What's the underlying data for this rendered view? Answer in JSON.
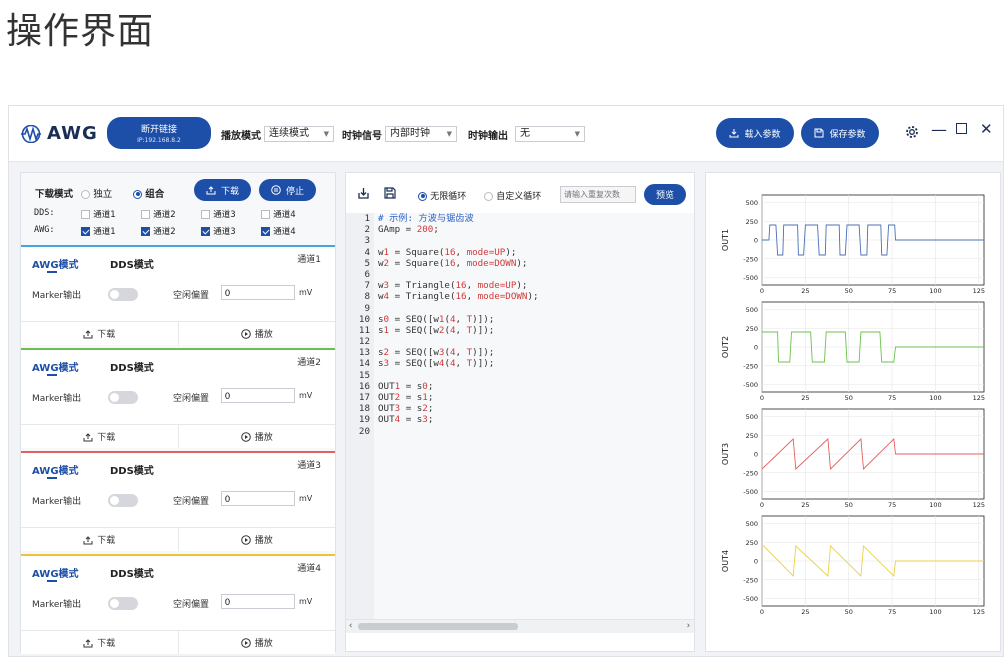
{
  "page_title": "操作界面",
  "app": {
    "logo_text": "AWG",
    "disconnect": {
      "label": "断开链接",
      "ip": "IP:192.168.8.2"
    },
    "play_mode": {
      "label": "播放模式",
      "value": "连续模式"
    },
    "clock_signal": {
      "label": "时钟信号",
      "value": "内部时钟"
    },
    "clock_output": {
      "label": "时钟输出",
      "value": "无"
    },
    "load_params": "载入参数",
    "save_params": "保存参数"
  },
  "left": {
    "download_mode_label": "下载模式",
    "independent": "独立",
    "combined": "组合",
    "download_btn": "下载",
    "stop_btn": "停止",
    "dds_label": "DDS:",
    "awg_label": "AWG:",
    "channels": [
      "通道1",
      "通道2",
      "通道3",
      "通道4"
    ],
    "dds_checked": [
      false,
      false,
      false,
      false
    ],
    "awg_checked": [
      true,
      true,
      true,
      true
    ]
  },
  "channel_cards": [
    {
      "awg_tab": "AWG模式",
      "dds_tab": "DDS模式",
      "name": "通道1",
      "marker": "Marker输出",
      "idle": "空闲偏置",
      "value": "0",
      "unit": "mV",
      "download": "下载",
      "play": "播放",
      "color": "#4aa3df"
    },
    {
      "awg_tab": "AWG模式",
      "dds_tab": "DDS模式",
      "name": "通道2",
      "marker": "Marker输出",
      "idle": "空闲偏置",
      "value": "0",
      "unit": "mV",
      "download": "下载",
      "play": "播放",
      "color": "#6cc14c"
    },
    {
      "awg_tab": "AWG模式",
      "dds_tab": "DDS模式",
      "name": "通道3",
      "marker": "Marker输出",
      "idle": "空闲偏置",
      "value": "0",
      "unit": "mV",
      "download": "下载",
      "play": "播放",
      "color": "#e26060"
    },
    {
      "awg_tab": "AWG模式",
      "dds_tab": "DDS模式",
      "name": "通道4",
      "marker": "Marker输出",
      "idle": "空闲偏置",
      "value": "0",
      "unit": "mV",
      "download": "下载",
      "play": "播放",
      "color": "#e8c53a"
    }
  ],
  "editor": {
    "infinite_loop": "无限循环",
    "custom_loop": "自定义循环",
    "repeat_placeholder": "请输入重复次数",
    "preview_btn": "预览",
    "line_numbers": [
      "1",
      "2",
      "3",
      "4",
      "5",
      "6",
      "7",
      "8",
      "9",
      "10",
      "11",
      "12",
      "13",
      "14",
      "15",
      "16",
      "17",
      "18",
      "19",
      "20"
    ],
    "code_lines": [
      "# 示例: 方波与锯齿波",
      "GAmp = 200;",
      "",
      "w1 = Square(16, mode=UP);",
      "w2 = Square(16, mode=DOWN);",
      "",
      "w3 = Triangle(16, mode=UP);",
      "w4 = Triangle(16, mode=DOWN);",
      "",
      "s0 = SEQ([w1(4, T)]);",
      "s1 = SEQ([w2(4, T)]);",
      "",
      "s2 = SEQ([w3(4, T)]);",
      "s3 = SEQ([w4(4, T)]);",
      "",
      "OUT1 = s0;",
      "OUT2 = s1;",
      "OUT3 = s2;",
      "OUT4 = s3;",
      ""
    ]
  },
  "chart_data": [
    {
      "type": "line",
      "ylabel": "OUT1",
      "color": "#4b6fb5",
      "x_ticks": [
        0,
        25,
        50,
        75,
        100,
        125
      ],
      "y_ticks": [
        500,
        250,
        0,
        -250,
        -500
      ],
      "xlim": [
        0,
        128
      ],
      "ylim": [
        -600,
        600
      ],
      "x": [
        0,
        4,
        4.5,
        8,
        9,
        12,
        12.5,
        16,
        17,
        20.5,
        21,
        24,
        25,
        28.5,
        29,
        32,
        33,
        36.5,
        37,
        40,
        41,
        44.5,
        45,
        48,
        49,
        52.5,
        53,
        56,
        57,
        60.5,
        61,
        64,
        65,
        68.5,
        69,
        72,
        73,
        76.5,
        77,
        128
      ],
      "y": [
        0,
        0,
        200,
        200,
        -200,
        -200,
        200,
        200,
        200,
        200,
        -200,
        -200,
        200,
        200,
        200,
        200,
        -200,
        -200,
        200,
        200,
        200,
        200,
        -200,
        -200,
        200,
        200,
        200,
        200,
        -200,
        -200,
        200,
        200,
        200,
        200,
        -200,
        -200,
        200,
        200,
        0,
        0
      ]
    },
    {
      "type": "line",
      "ylabel": "OUT2",
      "color": "#6cc14c",
      "x_ticks": [
        0,
        25,
        50,
        75,
        100,
        125
      ],
      "y_ticks": [
        500,
        250,
        0,
        -250,
        -500
      ],
      "xlim": [
        0,
        128
      ],
      "ylim": [
        -600,
        600
      ],
      "x": [
        0,
        9,
        9.5,
        16,
        17,
        20.5,
        21,
        28,
        29,
        36,
        37,
        40,
        41,
        48,
        49,
        56,
        57,
        60,
        61,
        68,
        69,
        76,
        77,
        128
      ],
      "y": [
        200,
        200,
        -200,
        -200,
        200,
        200,
        200,
        200,
        -200,
        -200,
        200,
        200,
        200,
        200,
        -200,
        -200,
        200,
        200,
        200,
        200,
        -200,
        -200,
        0,
        0
      ]
    },
    {
      "type": "line",
      "ylabel": "OUT3",
      "color": "#e26060",
      "x_ticks": [
        0,
        25,
        50,
        75,
        100,
        125
      ],
      "y_ticks": [
        500,
        250,
        0,
        -250,
        -500
      ],
      "xlim": [
        0,
        128
      ],
      "ylim": [
        -600,
        600
      ],
      "x": [
        0,
        18,
        19.5,
        38,
        39.5,
        57,
        58.5,
        76,
        77,
        128
      ],
      "y": [
        -200,
        200,
        -200,
        200,
        -200,
        200,
        -200,
        200,
        0,
        0
      ]
    },
    {
      "type": "line",
      "ylabel": "OUT4",
      "color": "#e8d24a",
      "x_ticks": [
        0,
        25,
        50,
        75,
        100,
        125
      ],
      "y_ticks": [
        500,
        250,
        0,
        -250,
        -500
      ],
      "xlim": [
        0,
        128
      ],
      "ylim": [
        -600,
        600
      ],
      "x": [
        0,
        1,
        18,
        19.5,
        38,
        39.5,
        57,
        58.5,
        76,
        77,
        128
      ],
      "y": [
        200,
        200,
        -200,
        200,
        -200,
        200,
        -200,
        200,
        -200,
        0,
        0
      ]
    }
  ]
}
